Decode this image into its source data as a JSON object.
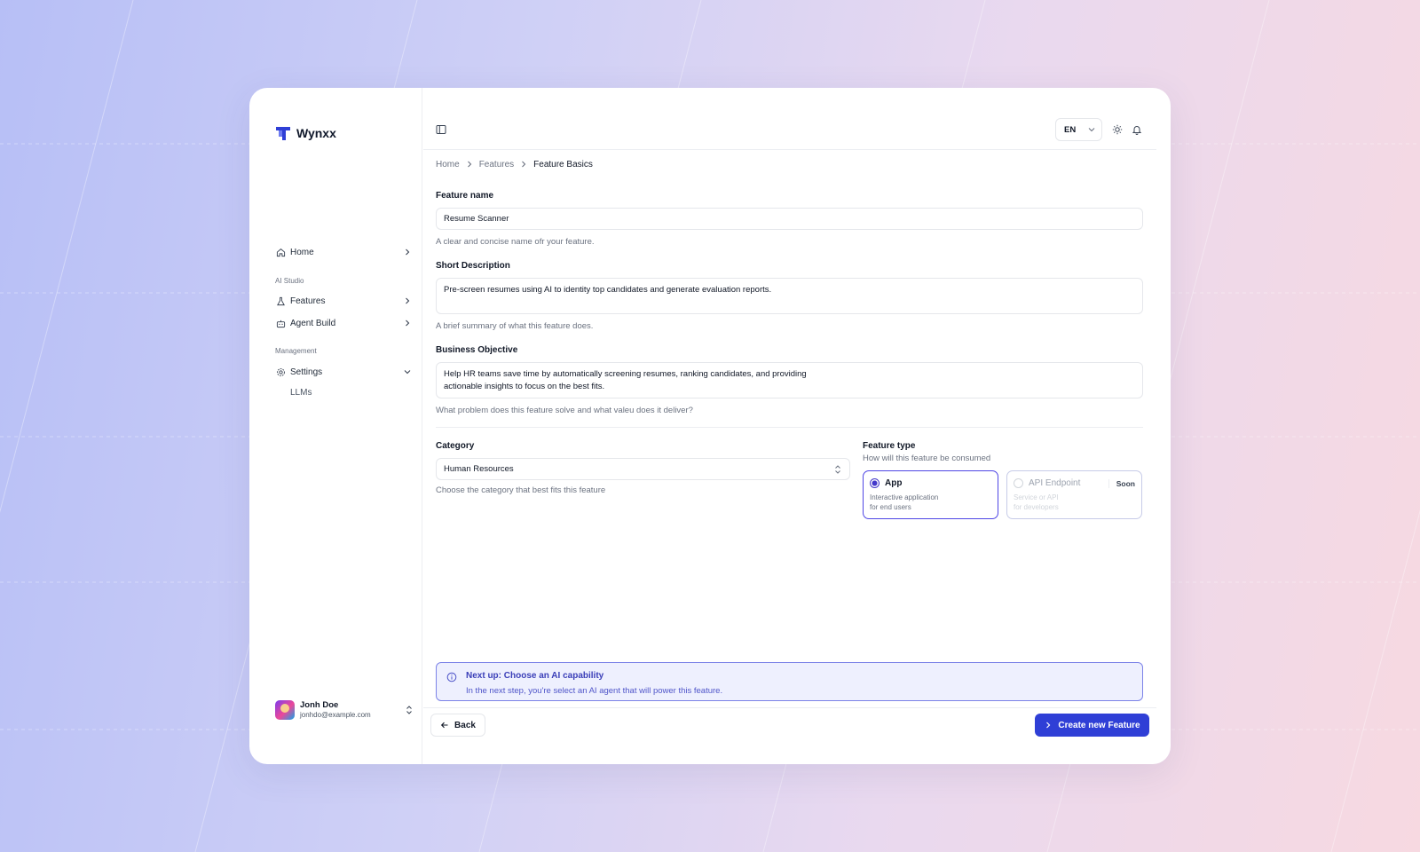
{
  "brand": {
    "name": "Wynxx",
    "accent": "#2f3fd6"
  },
  "sidebar": {
    "home": {
      "label": "Home",
      "icon": "home-icon"
    },
    "section_ai": "AI Studio",
    "features": {
      "label": "Features",
      "icon": "flask-icon"
    },
    "agent_build": {
      "label": "Agent Build",
      "icon": "bot-icon"
    },
    "section_management": "Management",
    "settings": {
      "label": "Settings",
      "icon": "gear-icon"
    },
    "settings_sub": [
      "LLMs"
    ],
    "user": {
      "name": "Jonh Doe",
      "email": "jonhdo@example.com"
    }
  },
  "topbar": {
    "language": "EN"
  },
  "breadcrumb": [
    "Home",
    "Features",
    "Feature Basics"
  ],
  "form": {
    "feature_name": {
      "label": "Feature name",
      "value": "Resume Scanner",
      "hint": "A clear and concise name ofr your feature."
    },
    "short_description": {
      "label": "Short Description",
      "value": "Pre-screen resumes using AI to identity top candidates and generate evaluation reports.",
      "hint": "A brief summary of what this feature does."
    },
    "business_objective": {
      "label": "Business Objective",
      "value_line1": "Help HR teams save time by automatically screening resumes, ranking candidates, and providing",
      "value_line2": "actionable insights to focus on the best fits.",
      "hint": "What problem does this feature solve and what valeu does it deliver?"
    },
    "category": {
      "label": "Category",
      "value": "Human Resources",
      "hint": "Choose the category that best fits this feature"
    },
    "feature_type": {
      "label": "Feature type",
      "hint": "How will this feature be consumed",
      "options": [
        {
          "title": "App",
          "desc1": "Interactive application",
          "desc2": "for end users",
          "selected": true
        },
        {
          "title": "API Endpoint",
          "badge": "Soon",
          "desc1": "Service or API",
          "desc2": "for developers",
          "selected": false
        }
      ]
    }
  },
  "info": {
    "title": "Next up: Choose an AI capability",
    "desc": "In the next step, you're select an AI agent that will power this feature."
  },
  "actions": {
    "back": "Back",
    "create": "Create new Feature"
  }
}
